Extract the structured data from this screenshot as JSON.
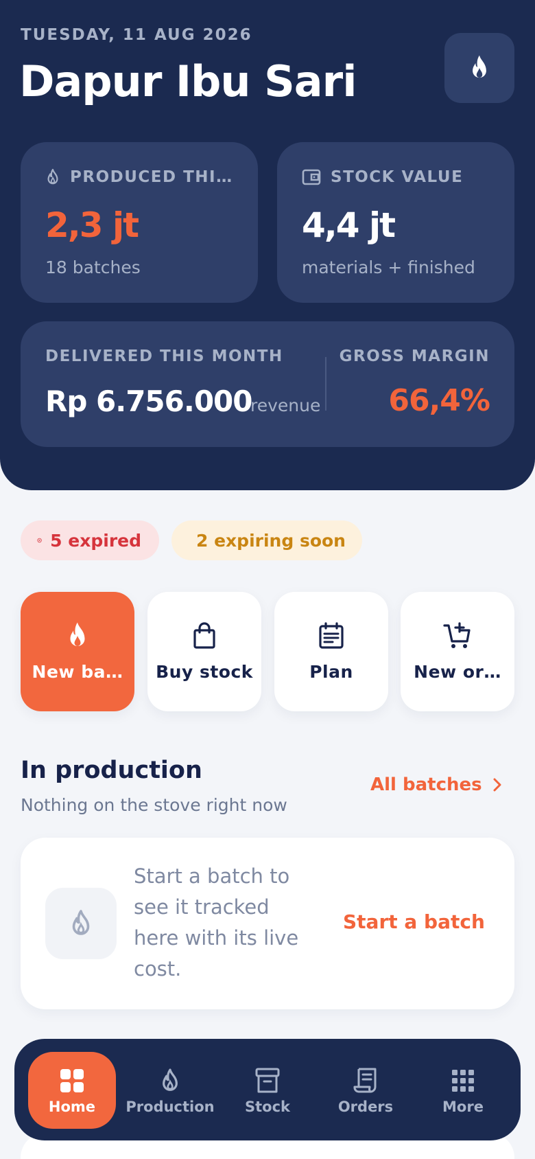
{
  "header": {
    "date": "TUESDAY, 11 AUG 2026",
    "title": "Dapur Ibu Sari",
    "action_icon": "flame-icon"
  },
  "stats": {
    "produced": {
      "label": "PRODUCED THI…",
      "value": "2,3 jt",
      "sub": "18 batches",
      "icon": "flame-icon"
    },
    "stock": {
      "label": "STOCK VALUE",
      "value": "4,4 jt",
      "sub": "materials + finished",
      "icon": "wallet-icon"
    },
    "delivered": {
      "label": "DELIVERED THIS MONTH",
      "value": "Rp 6.756.000",
      "unit": "revenue"
    },
    "margin": {
      "label": "GROSS MARGIN",
      "value": "66,4%"
    }
  },
  "alerts": {
    "expired": "5 expired",
    "expiring": "2 expiring soon"
  },
  "quick_actions": [
    {
      "label": "New ba…",
      "icon": "flame-icon"
    },
    {
      "label": "Buy stock",
      "icon": "shopping-bag-icon"
    },
    {
      "label": "Plan",
      "icon": "calendar-icon"
    },
    {
      "label": "New or…",
      "icon": "cart-add-icon"
    }
  ],
  "production": {
    "title": "In production",
    "subtitle": "Nothing on the stove right now",
    "link": "All batches",
    "empty_text": "Start a batch to see it tracked here with its live cost.",
    "empty_action": "Start a batch"
  },
  "nav": [
    {
      "label": "Home",
      "icon": "grid-icon",
      "active": true
    },
    {
      "label": "Production",
      "icon": "flame-icon"
    },
    {
      "label": "Stock",
      "icon": "archive-icon"
    },
    {
      "label": "Orders",
      "icon": "receipt-icon"
    },
    {
      "label": "More",
      "icon": "apps-icon"
    }
  ],
  "colors": {
    "navy": "#1b2a50",
    "card": "#2f3f69",
    "accent": "#f2643b",
    "danger": "#d6343c",
    "warning": "#c98512"
  }
}
